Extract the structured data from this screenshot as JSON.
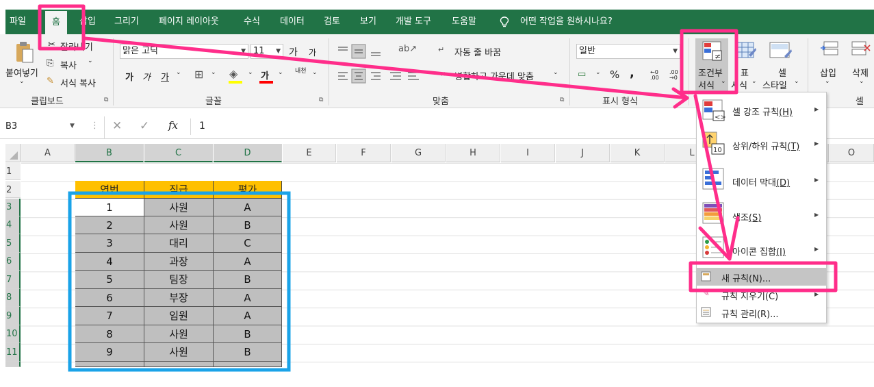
{
  "menu": {
    "tabs": [
      "파일",
      "홈",
      "삽입",
      "그리기",
      "페이지 레이아웃",
      "수식",
      "데이터",
      "검토",
      "보기",
      "개발 도구",
      "도움말"
    ],
    "tell_me": "어떤 작업을 원하시나요?"
  },
  "ribbon": {
    "clipboard": {
      "paste": "붙여넣기",
      "cut": "잘라내기",
      "copy": "복사",
      "format_painter": "서식 복사",
      "label": "클립보드"
    },
    "font": {
      "name": "맑은 고딕",
      "size": "11",
      "grow": "가",
      "shrink": "가",
      "bold": "가",
      "italic": "가",
      "underline": "가",
      "font_color": "가",
      "phonetic": "내천",
      "label": "글꼴"
    },
    "alignment": {
      "wrap_text": "자동 줄 바꿈",
      "merge_center": "병합하고 가운데 맞춤",
      "label": "맞춤"
    },
    "number": {
      "format": "일반",
      "percent": "%",
      "comma": ",",
      "label": "표시 형식"
    },
    "styles": {
      "conditional_formatting_line1": "조건부",
      "conditional_formatting_line2": "서식",
      "format_table_line1": "표",
      "format_table_line2": "서식",
      "cell_styles_line1": "셀",
      "cell_styles_line2": "스타일",
      "label": ""
    },
    "cells": {
      "insert": "삽입",
      "delete": "삭제",
      "label": "셀"
    }
  },
  "formula_bar": {
    "name_box": "B3",
    "cancel": "✕",
    "enter": "✓",
    "fx": "fx",
    "value": "1"
  },
  "sheet": {
    "columns": [
      "A",
      "B",
      "C",
      "D",
      "E",
      "F",
      "G",
      "H",
      "I",
      "J",
      "K",
      "L",
      "O"
    ],
    "rows": [
      "1",
      "2",
      "3",
      "4",
      "5",
      "6",
      "7",
      "8",
      "9",
      "10",
      "11"
    ],
    "header": [
      "연번",
      "직급",
      "평가"
    ],
    "data": [
      [
        "1",
        "사원",
        "A"
      ],
      [
        "2",
        "사원",
        "B"
      ],
      [
        "3",
        "대리",
        "C"
      ],
      [
        "4",
        "과장",
        "A"
      ],
      [
        "5",
        "팀장",
        "B"
      ],
      [
        "6",
        "부장",
        "A"
      ],
      [
        "7",
        "임원",
        "A"
      ],
      [
        "8",
        "사원",
        "B"
      ],
      [
        "9",
        "사원",
        "B"
      ]
    ]
  },
  "conditional_menu": {
    "items": [
      {
        "label": "셀 강조 규칙",
        "key": "(H)"
      },
      {
        "label": "상위/하위 규칙",
        "key": "(T)"
      },
      {
        "label": "데이터 막대",
        "key": "(D)"
      },
      {
        "label": "색조",
        "key": "(S)"
      },
      {
        "label": "아이콘 집합",
        "key": "(I)"
      }
    ],
    "new_rule": "새 규칙(N)...",
    "clear_rules": "규칙 지우기(C)",
    "manage_rules": "규칙 관리(R)..."
  },
  "colors": {
    "excel_green": "#217346",
    "annotation_pink": "#ff2d8a",
    "annotation_blue": "#1aa3e8",
    "header_fill": "#ffc000",
    "data_fill": "#bfbfbf"
  }
}
